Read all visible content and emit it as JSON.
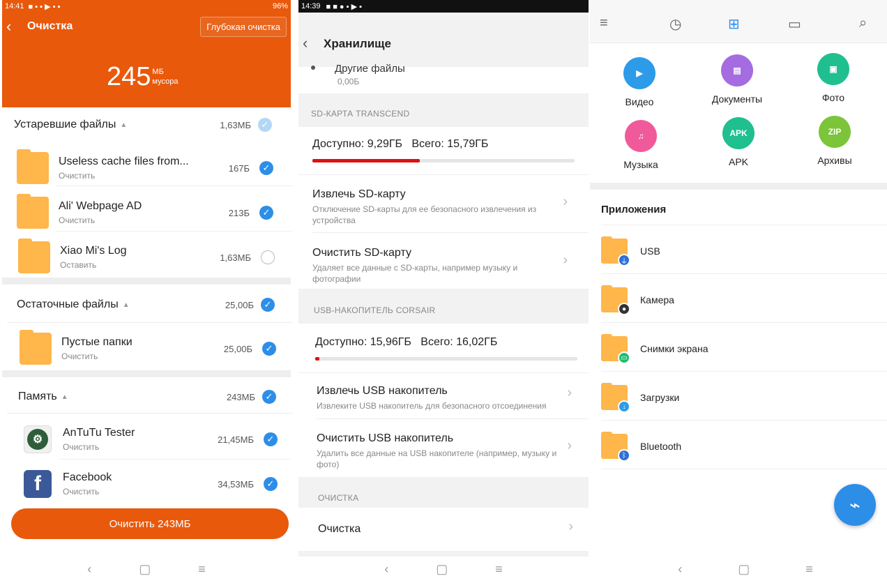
{
  "cleaner": {
    "status_time": "14:41",
    "status_battery": "96%",
    "title": "Очистка",
    "deep_clean": "Глубокая очистка",
    "junk_value": "245",
    "junk_unit": "МБ",
    "junk_label": "мусора",
    "sections": [
      {
        "title": "Устаревшие файлы",
        "size": "1,63МБ",
        "items": [
          {
            "title": "Useless cache files from...",
            "sub": "Очистить",
            "size": "167Б"
          },
          {
            "title": "Ali' Webpage AD",
            "sub": "Очистить",
            "size": "213Б"
          },
          {
            "title": "Xiao Mi's Log",
            "sub": "Оставить",
            "size": "1,63МБ"
          }
        ]
      },
      {
        "title": "Остаточные файлы",
        "size": "25,00Б",
        "items": [
          {
            "title": "Пустые папки",
            "sub": "Очистить",
            "size": "25,00Б"
          }
        ]
      },
      {
        "title": "Память",
        "size": "243МБ",
        "items": [
          {
            "title": "AnTuTu Tester",
            "sub": "Очистить",
            "size": "21,45МБ"
          },
          {
            "title": "Facebook",
            "sub": "Очистить",
            "size": "34,53МБ"
          }
        ]
      }
    ],
    "clean_button": "Очистить 243МБ"
  },
  "storage": {
    "status_time": "14:39",
    "title": "Хранилище",
    "other_files": "Другие файлы",
    "other_files_size": "0,00Б",
    "sd_caption": "SD-КАРТА TRANSCEND",
    "sd_available": "Доступно: 9,29ГБ",
    "sd_total": "Всего: 15,79ГБ",
    "sd_used_fraction": 0.41,
    "sd_eject_title": "Извлечь SD-карту",
    "sd_eject_sub": "Отключение SD-карты для ее безопасного извлечения из устройства",
    "sd_clear_title": "Очистить SD-карту",
    "sd_clear_sub": "Удаляет все данные с SD-карты, например музыку и фотографии",
    "usb_caption": "USB-НАКОПИТЕЛЬ CORSAIR",
    "usb_available": "Доступно: 15,96ГБ",
    "usb_total": "Всего: 16,02ГБ",
    "usb_used_fraction": 0.01,
    "usb_eject_title": "Извлечь USB накопитель",
    "usb_eject_sub": "Извлеките USB накопитель для безопасного отсоединения",
    "usb_clear_title": "Очистить USB накопитель",
    "usb_clear_sub": "Удалить все данные на USB накопителе (например, музыку и фото)",
    "clean_caption": "ОЧИСТКА",
    "clean_item": "Очистка"
  },
  "files": {
    "categories": [
      {
        "label": "Видео",
        "glyph": "▶",
        "color": "#2d9be8"
      },
      {
        "label": "Документы",
        "glyph": "▤",
        "color": "#a56be0"
      },
      {
        "label": "Фото",
        "glyph": "▣",
        "color": "#1fbf8f"
      },
      {
        "label": "Музыка",
        "glyph": "♫",
        "color": "#f05a9b"
      },
      {
        "label": "APK",
        "glyph": "APK",
        "color": "#1fbf8f"
      },
      {
        "label": "Архивы",
        "glyph": "ZIP",
        "color": "#7cc43a"
      }
    ],
    "apps_heading": "Приложения",
    "apps": [
      {
        "name": "USB",
        "badge_color": "#2d6fd8",
        "badge": "⏚"
      },
      {
        "name": "Камера",
        "badge_color": "#333333",
        "badge": "●"
      },
      {
        "name": "Снимки экрана",
        "badge_color": "#1fbf6f",
        "badge": "▭"
      },
      {
        "name": "Загрузки",
        "badge_color": "#2d9be8",
        "badge": "↓"
      },
      {
        "name": "Bluetooth",
        "badge_color": "#2d6fd8",
        "badge": "ᛒ"
      }
    ]
  }
}
